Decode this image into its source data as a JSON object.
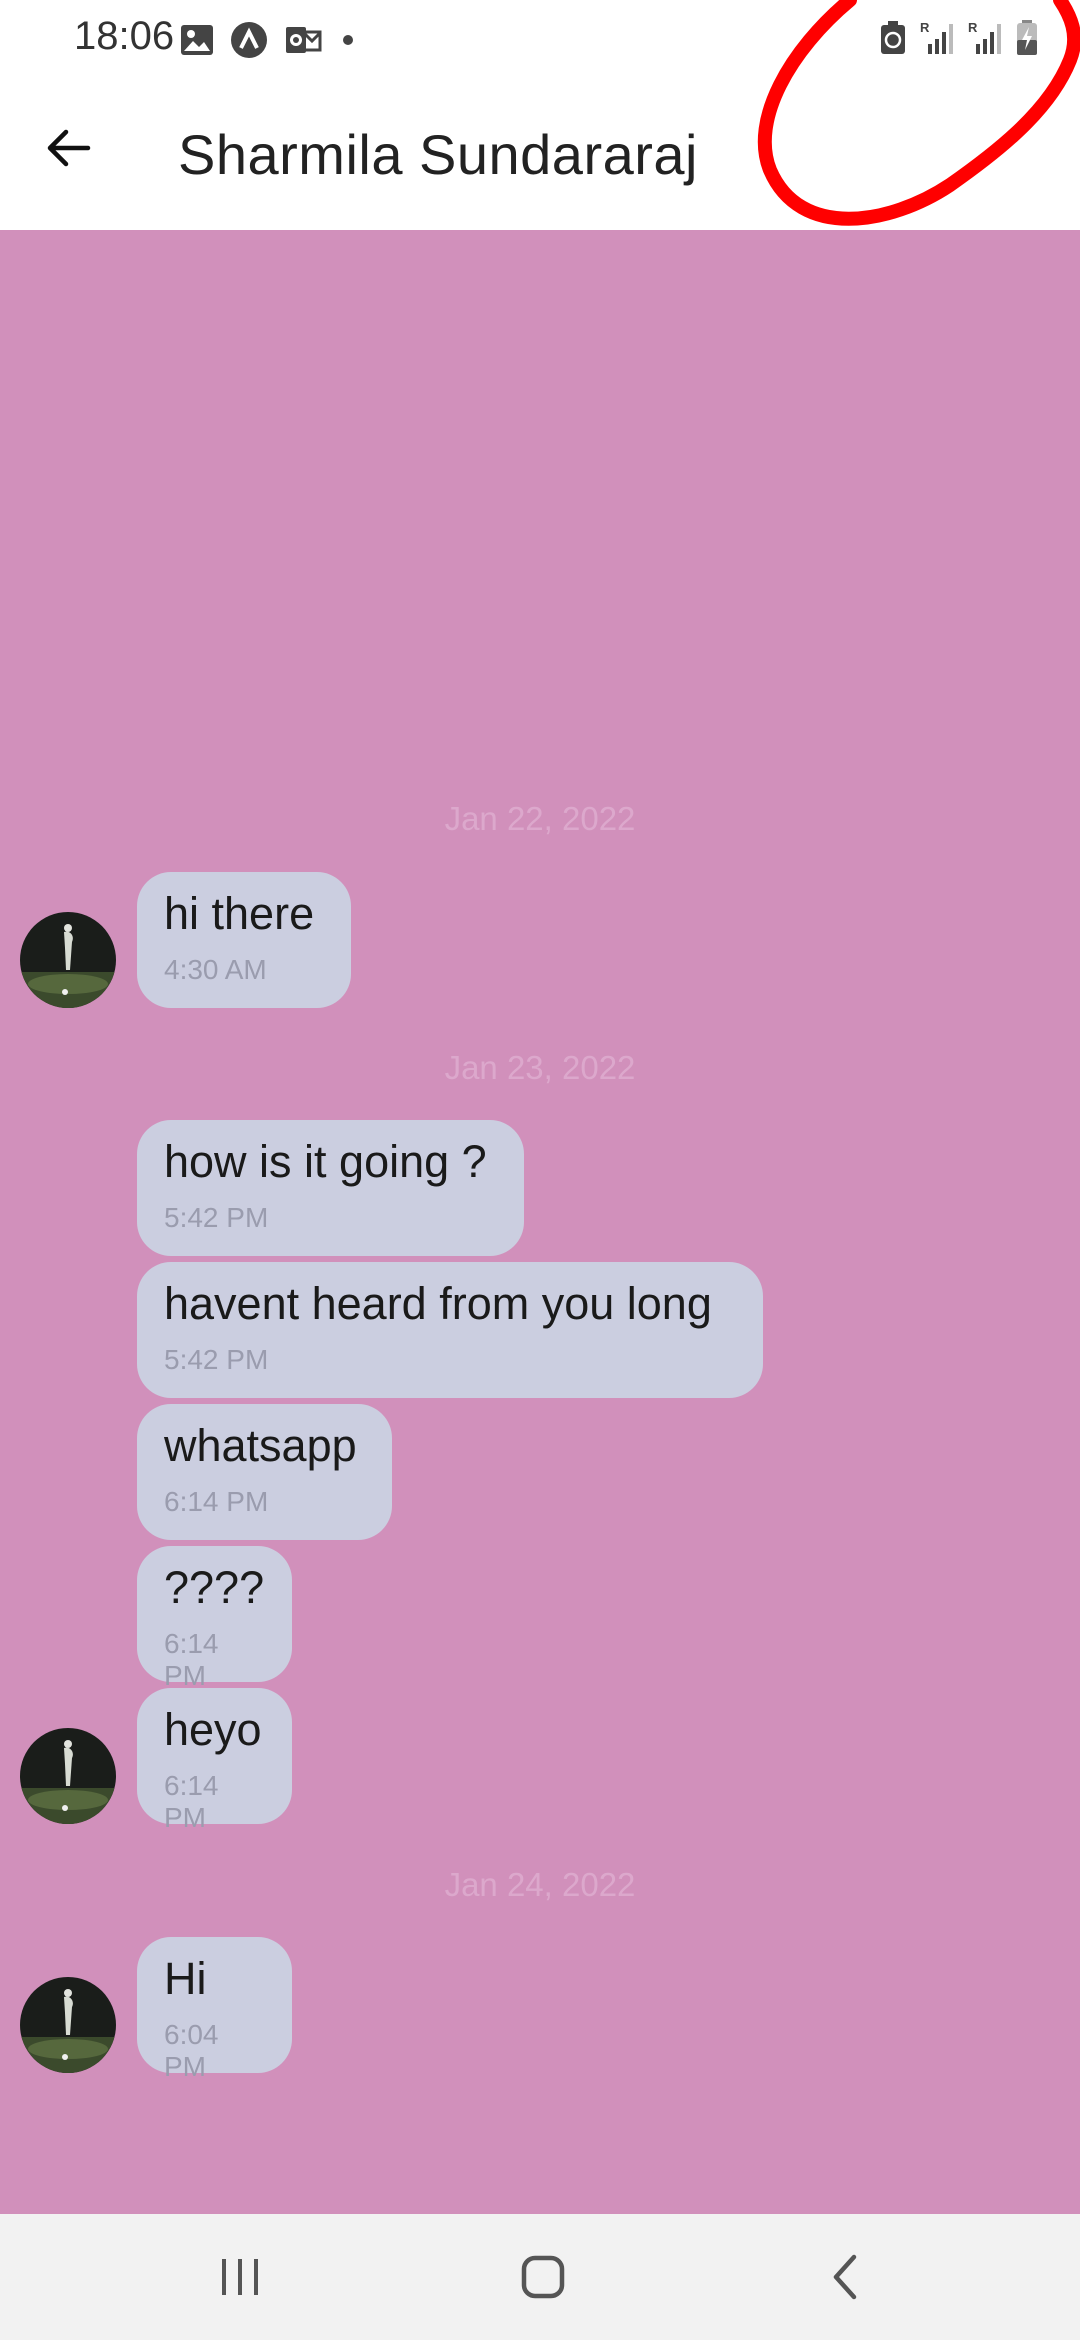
{
  "status_bar": {
    "time": "18:06",
    "left_icons": [
      "gallery-icon",
      "app-icon",
      "outlook-icon",
      "dot-icon"
    ],
    "right_icons": [
      "battery-saver-icon",
      "signal-roaming-icon",
      "signal-roaming-icon",
      "battery-charging-icon"
    ]
  },
  "header": {
    "title": "Sharmila Sundararaj"
  },
  "annotation_color": "#ff0000",
  "chat": {
    "background": "#d190bb",
    "bubble_color": "#cbcee0",
    "date_1": "Jan 22, 2022",
    "date_2": "Jan 23, 2022",
    "date_3": "Jan 24, 2022",
    "messages": [
      {
        "text": "hi there",
        "time": "4:30 AM"
      },
      {
        "text": "how is it going ?",
        "time": "5:42 PM"
      },
      {
        "text": "havent heard from you long",
        "time": "5:42 PM"
      },
      {
        "text": "whatsapp",
        "time": "6:14 PM"
      },
      {
        "text": "????",
        "time": "6:14 PM"
      },
      {
        "text": "heyo",
        "time": "6:14 PM"
      },
      {
        "text": "Hi",
        "time": "6:04 PM"
      }
    ]
  },
  "nav": {
    "icons": [
      "recents-icon",
      "home-icon",
      "back-icon"
    ]
  }
}
